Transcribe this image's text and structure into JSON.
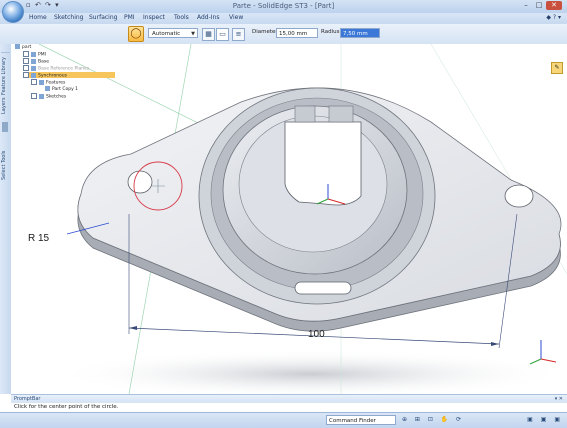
{
  "titlebar": {
    "title": "Parte - SolidEdge ST3 - [Part]",
    "qat": "▫ ↶ ↷ ▾",
    "minimize": "–",
    "maximize": "□",
    "close": "✕"
  },
  "ribbon": {
    "tabs": [
      "Home",
      "Sketching",
      "Surfacing",
      "PMI",
      "Inspect",
      "Tools",
      "Add-Ins",
      "View"
    ],
    "help": "◆ ? ▾",
    "mode_value": "Automatic",
    "diameter_label": "Diameter:",
    "diameter_value": "15,00 mm",
    "radius_label": "Radius:",
    "radius_value": "7,50 mm"
  },
  "left_strip": {
    "tab_features": "Feature Library",
    "tab_layers": "Layers",
    "tab_select": "Select Tools"
  },
  "tree": {
    "items": [
      {
        "label": "part",
        "style": "normal"
      },
      {
        "label": "PMI",
        "style": "normal"
      },
      {
        "label": "Base",
        "style": "normal"
      },
      {
        "label": "Base Reference Planes",
        "style": "dim"
      },
      {
        "label": "Synchronous",
        "style": "selected"
      },
      {
        "label": "Features",
        "style": "normal"
      },
      {
        "label": "Part Copy 1",
        "style": "normal"
      },
      {
        "label": "Sketches",
        "style": "normal"
      }
    ]
  },
  "viewport": {
    "dim_radius": "R 15",
    "dim_length": "100",
    "accent_circle_color": "#d83a4a",
    "triad_x_color": "#d62828",
    "triad_y_color": "#2fa33a",
    "triad_z_color": "#2c4bd1"
  },
  "prompt": {
    "title": "PromptBar",
    "close": "▾ ✕",
    "message": "Click for the center point of the circle."
  },
  "status": {
    "command_finder": "Command Finder",
    "icons": "⊕ ⊞ ⊡ ✋ ⟳",
    "right_icons": "▣ ▣ ▣"
  }
}
